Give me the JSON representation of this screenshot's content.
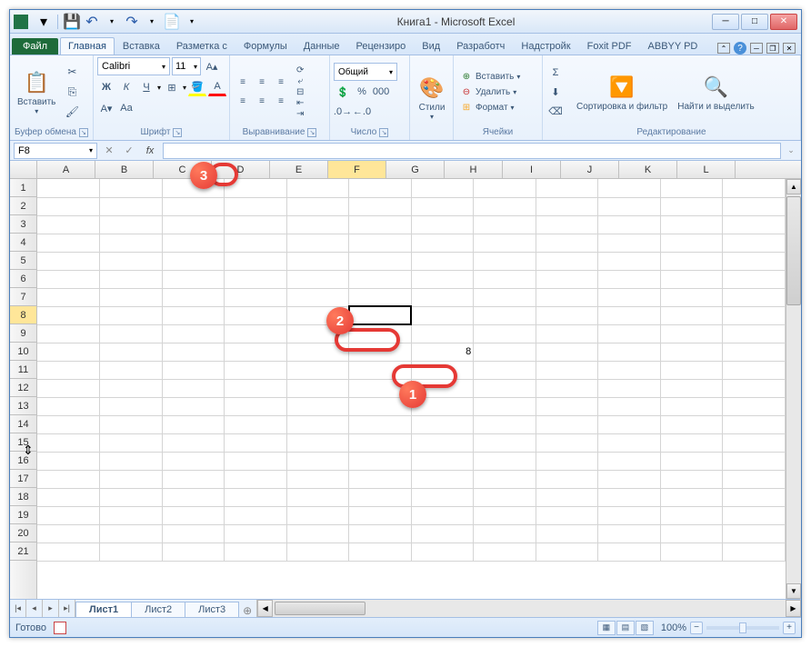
{
  "title": "Книга1  -  Microsoft Excel",
  "tabs": {
    "file": "Файл",
    "items": [
      "Главная",
      "Вставка",
      "Разметка с",
      "Формулы",
      "Данные",
      "Рецензиро",
      "Вид",
      "Разработч",
      "Надстройк",
      "Foxit PDF",
      "ABBYY PD"
    ],
    "active": 0
  },
  "ribbon": {
    "clipboard": {
      "paste": "Вставить",
      "label": "Буфер обмена"
    },
    "font": {
      "name": "Calibri",
      "size": "11",
      "label": "Шрифт"
    },
    "alignment": {
      "label": "Выравнивание"
    },
    "number": {
      "format": "Общий",
      "label": "Число"
    },
    "styles": {
      "btn": "Стили",
      "label": ""
    },
    "cells": {
      "insert": "Вставить",
      "delete": "Удалить",
      "format": "Формат",
      "label": "Ячейки"
    },
    "editing": {
      "sort": "Сортировка и фильтр",
      "find": "Найти и выделить",
      "label": "Редактирование"
    }
  },
  "formula_bar": {
    "name_box": "F8",
    "fx": "fx",
    "value": ""
  },
  "grid": {
    "columns": [
      "A",
      "B",
      "C",
      "D",
      "E",
      "F",
      "G",
      "H",
      "I",
      "J",
      "K",
      "L"
    ],
    "rows": [
      "1",
      "2",
      "3",
      "4",
      "5",
      "6",
      "7",
      "8",
      "9",
      "10",
      "11",
      "12",
      "13",
      "14",
      "15",
      "16",
      "17",
      "18",
      "19",
      "20",
      "21"
    ],
    "active_col": "F",
    "active_row": "8",
    "cell_G10": "8"
  },
  "sheets": {
    "items": [
      "Лист1",
      "Лист2",
      "Лист3"
    ],
    "active": 0
  },
  "status": {
    "ready": "Готово",
    "zoom": "100%"
  },
  "callouts": {
    "b1": "1",
    "b2": "2",
    "b3": "3"
  }
}
